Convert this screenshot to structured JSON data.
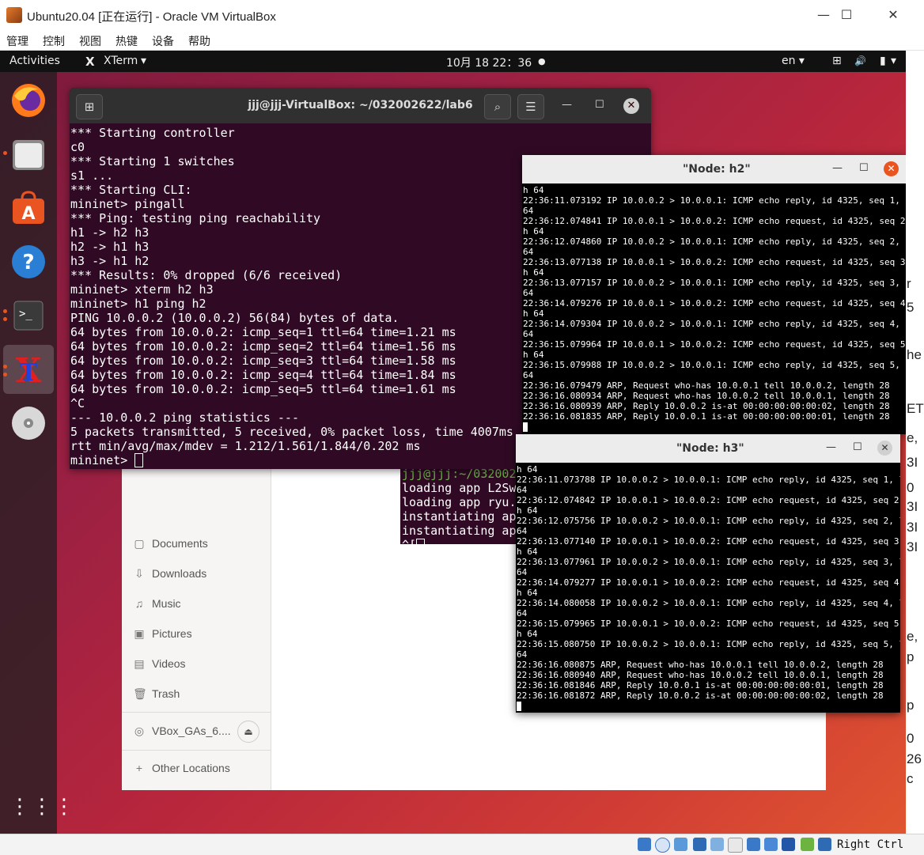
{
  "vbox": {
    "title": "Ubuntu20.04 [正在运行] - Oracle VM VirtualBox",
    "controls": {
      "minimize": "—",
      "maximize": "☐",
      "close": "✕"
    },
    "menu": [
      "管理",
      "控制",
      "视图",
      "热键",
      "设备",
      "帮助"
    ],
    "host_key": "Right Ctrl",
    "right_strip_slivers": [
      "r",
      "5",
      "he",
      "ET",
      "e,",
      "3I",
      "0",
      "3I",
      "3I",
      "3I",
      "e,",
      "p",
      "p",
      "0",
      "26",
      "c"
    ]
  },
  "gnome": {
    "activities": "Activities",
    "app_menu": "XTerm",
    "app_menu_arrow": "▾",
    "clock": "10月 18 22：36",
    "clock_dot": "●",
    "lang": "en ▾",
    "tray": {
      "network": "⊞",
      "volume": "🔊",
      "battery": "▮",
      "arrow": "▾"
    }
  },
  "dock": {
    "items": [
      "firefox",
      "files",
      "software",
      "help",
      "terminal",
      "xterm",
      "disc",
      "apps-grid"
    ],
    "apps_grid_glyph": "⋮⋮⋮"
  },
  "files": {
    "sidebar": [
      {
        "icon": "▢",
        "label": "Documents"
      },
      {
        "icon": "⇩",
        "label": "Downloads"
      },
      {
        "icon": "♫",
        "label": "Music"
      },
      {
        "icon": "▣",
        "label": "Pictures"
      },
      {
        "icon": "▤",
        "label": "Videos"
      },
      {
        "icon": "🗑",
        "label": "Trash"
      }
    ],
    "drive": {
      "label": "VBox_GAs_6....",
      "eject": "⏏"
    },
    "other": {
      "icon": "+",
      "label": "Other Locations"
    }
  },
  "term_main": {
    "title": "jjj@jjj-VirtualBox: ~/032002622/lab6",
    "new_tab": "⊞",
    "search": "⌕",
    "menu": "☰",
    "minimize": "—",
    "maximize": "☐",
    "close": "✕",
    "lines": [
      "*** Starting controller",
      "c0",
      "*** Starting 1 switches",
      "s1 ...",
      "*** Starting CLI:",
      "mininet> pingall",
      "*** Ping: testing ping reachability",
      "h1 -> h2 h3",
      "h2 -> h1 h3",
      "h3 -> h1 h2",
      "*** Results: 0% dropped (6/6 received)",
      "mininet> xterm h2 h3",
      "mininet> h1 ping h2",
      "PING 10.0.0.2 (10.0.0.2) 56(84) bytes of data.",
      "64 bytes from 10.0.0.2: icmp_seq=1 ttl=64 time=1.21 ms",
      "64 bytes from 10.0.0.2: icmp_seq=2 ttl=64 time=1.56 ms",
      "64 bytes from 10.0.0.2: icmp_seq=3 ttl=64 time=1.58 ms",
      "64 bytes from 10.0.0.2: icmp_seq=4 ttl=64 time=1.84 ms",
      "64 bytes from 10.0.0.2: icmp_seq=5 ttl=64 time=1.61 ms",
      "^C",
      "--- 10.0.0.2 ping statistics ---",
      "5 packets transmitted, 5 received, 0% packet loss, time 4007ms",
      "rtt min/avg/max/mdev = 1.212/1.561/1.844/0.202 ms"
    ],
    "prompt": "mininet> "
  },
  "term_ryu": {
    "lines": [
      "jjj@jjj:~/032002",
      "loading app L2Sw",
      "loading app ryu.",
      "instantiating ap",
      "instantiating ap",
      "^["
    ]
  },
  "node_h2": {
    "title": "\"Node: h2\"",
    "minimize": "—",
    "maximize": "☐",
    "close": "✕",
    "lines": [
      "h 64",
      "22:36:11.073192 IP 10.0.0.2 > 10.0.0.1: ICMP echo reply, id 4325, seq 1, length",
      "64",
      "22:36:12.074841 IP 10.0.0.1 > 10.0.0.2: ICMP echo request, id 4325, seq 2, lengt",
      "h 64",
      "22:36:12.074860 IP 10.0.0.2 > 10.0.0.1: ICMP echo reply, id 4325, seq 2, length",
      "64",
      "22:36:13.077138 IP 10.0.0.1 > 10.0.0.2: ICMP echo request, id 4325, seq 3, lengt",
      "h 64",
      "22:36:13.077157 IP 10.0.0.2 > 10.0.0.1: ICMP echo reply, id 4325, seq 3, length",
      "64",
      "22:36:14.079276 IP 10.0.0.1 > 10.0.0.2: ICMP echo request, id 4325, seq 4, lengt",
      "h 64",
      "22:36:14.079304 IP 10.0.0.2 > 10.0.0.1: ICMP echo reply, id 4325, seq 4, length",
      "64",
      "22:36:15.079964 IP 10.0.0.1 > 10.0.0.2: ICMP echo request, id 4325, seq 5, lengt",
      "h 64",
      "22:36:15.079988 IP 10.0.0.2 > 10.0.0.1: ICMP echo reply, id 4325, seq 5, length",
      "64",
      "22:36:16.079479 ARP, Request who-has 10.0.0.1 tell 10.0.0.2, length 28",
      "22:36:16.080934 ARP, Request who-has 10.0.0.2 tell 10.0.0.1, length 28",
      "22:36:16.080939 ARP, Reply 10.0.0.2 is-at 00:00:00:00:00:02, length 28",
      "22:36:16.081835 ARP, Reply 10.0.0.1 is-at 00:00:00:00:00:01, length 28"
    ]
  },
  "node_h3": {
    "title": "\"Node: h3\"",
    "minimize": "—",
    "maximize": "☐",
    "close": "✕",
    "lines": [
      "h 64",
      "22:36:11.073788 IP 10.0.0.2 > 10.0.0.1: ICMP echo reply, id 4325, seq 1, length",
      "64",
      "22:36:12.074842 IP 10.0.0.1 > 10.0.0.2: ICMP echo request, id 4325, seq 2, lengt",
      "h 64",
      "22:36:12.075756 IP 10.0.0.2 > 10.0.0.1: ICMP echo reply, id 4325, seq 2, length",
      "64",
      "22:36:13.077140 IP 10.0.0.1 > 10.0.0.2: ICMP echo request, id 4325, seq 3, lengt",
      "h 64",
      "22:36:13.077961 IP 10.0.0.2 > 10.0.0.1: ICMP echo reply, id 4325, seq 3, length",
      "64",
      "22:36:14.079277 IP 10.0.0.1 > 10.0.0.2: ICMP echo request, id 4325, seq 4, lengt",
      "h 64",
      "22:36:14.080058 IP 10.0.0.2 > 10.0.0.1: ICMP echo reply, id 4325, seq 4, length",
      "64",
      "22:36:15.079965 IP 10.0.0.1 > 10.0.0.2: ICMP echo request, id 4325, seq 5, lengt",
      "h 64",
      "22:36:15.080750 IP 10.0.0.2 > 10.0.0.1: ICMP echo reply, id 4325, seq 5, length",
      "64",
      "22:36:16.080875 ARP, Request who-has 10.0.0.1 tell 10.0.0.2, length 28",
      "22:36:16.080940 ARP, Request who-has 10.0.0.2 tell 10.0.0.1, length 28",
      "22:36:16.081846 ARP, Reply 10.0.0.1 is-at 00:00:00:00:00:01, length 28",
      "22:36:16.081872 ARP, Reply 10.0.0.2 is-at 00:00:00:00:00:02, length 28"
    ]
  },
  "colors": {
    "terminal_bg": "#300a24",
    "ubuntu_orange": "#e95420",
    "close_red": "#e9541f"
  }
}
